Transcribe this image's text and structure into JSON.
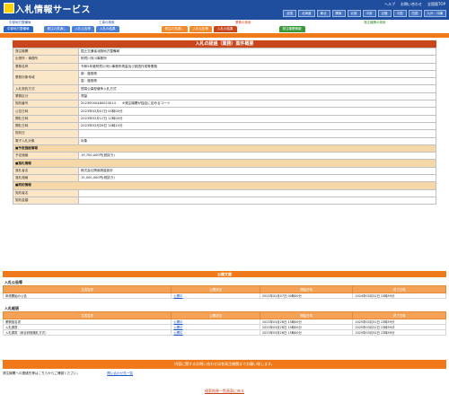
{
  "header": {
    "title": "入札情報サービス",
    "links": [
      "ヘルプ",
      "お問い合わせ",
      "全国版TOP"
    ],
    "regions": [
      "全国",
      "北海道",
      "東北",
      "関東",
      "北陸",
      "中部",
      "近畿",
      "中国",
      "四国",
      "九州・沖縄"
    ]
  },
  "tabs": {
    "group1_label": "中部地方整備局",
    "group2_label": "工事の検索",
    "group3_label": "業務の検索",
    "group4_label": "発注機関の検索",
    "items": [
      "中部地方整備局",
      "発注の見通し",
      "入札公告等",
      "入札の結果",
      "発注の見通し",
      "入札公告等",
      "入札の結果",
      "発注機関情報"
    ]
  },
  "detail": {
    "title": "入札の経過（業務）案件概要",
    "rows": [
      {
        "k": "発注機関",
        "v": "国土交通省北陸地方整備局"
      },
      {
        "k": "出張所・事務所",
        "v": "阿賀川河川事務所"
      },
      {
        "k": "業務名称",
        "v": "令和5年度阿賀川河川事務所測量及び設図作成等業務"
      },
      {
        "k": "業務対象地域",
        "v": "新：福島県"
      },
      {
        "k": "",
        "v": "富：福島県"
      },
      {
        "k": "入札契約方式",
        "v": "簡易公募型競争入札方式"
      },
      {
        "k": "業務区分",
        "v": "測量"
      },
      {
        "k": "契約番号",
        "v": "20230000480023014　　※発注機関が独自に定めるコード"
      },
      {
        "k": "公告日時",
        "v": "2023年02月07日 00時00分"
      },
      {
        "k": "開札日時",
        "v": "2023年02月17日 12時00分"
      },
      {
        "k": "開札日時",
        "v": "2023年03月28日 14時10分"
      },
      {
        "k": "契約日",
        "v": ""
      },
      {
        "k": "電子入札対象",
        "v": "対象"
      }
    ],
    "section_estimate": "■予定価格情報",
    "estimate_rows": [
      {
        "k": "予定価格",
        "v": "19,700,000円(税抜き)"
      }
    ],
    "section_winner": "■落札情報",
    "winner_rows": [
      {
        "k": "落札者名",
        "v": "株式会社興南測量設計"
      },
      {
        "k": "落札価格",
        "v": "15,000,000円(税抜き)"
      }
    ],
    "section_contract": "■契約情報",
    "contract_rows": [
      {
        "k": "契約者名",
        "v": ""
      },
      {
        "k": "契約金額",
        "v": ""
      }
    ]
  },
  "public_docs": {
    "title": "公開文書",
    "columns": [
      "文書名称",
      "公開状況",
      "開始日時",
      "終了日時"
    ],
    "group1": "入札公告等",
    "group1_rows": [
      {
        "name": "申請開始の公告",
        "status": "公開中",
        "start": "2023年02月07日 00時00分",
        "end": "2024年03月31日 23時59分"
      }
    ],
    "group2": "入札経過",
    "group2_rows": [
      {
        "name": "業務指名書",
        "status": "公開中",
        "start": "2023年03月28日 15時00分",
        "end": "2025年03月31日 23時59分"
      },
      {
        "name": "入札調書",
        "status": "公開中",
        "start": "2023年03月28日 15時00分",
        "end": "2025年03月31日 23時59分"
      },
      {
        "name": "入札調書（総合評価落札方式）",
        "status": "公開中",
        "start": "2023年03月28日 15時00分",
        "end": "2025年03月31日 23時59分"
      }
    ]
  },
  "footer": {
    "notice": "内容に関するお問い合わせは各発注機関までお願い致します。",
    "contact_text": "発注機関への連絡先等はこちらからご確認ください。",
    "contact_link": "問い合わせ先一覧",
    "back_link": "検索結果一覧画面に戻る"
  }
}
